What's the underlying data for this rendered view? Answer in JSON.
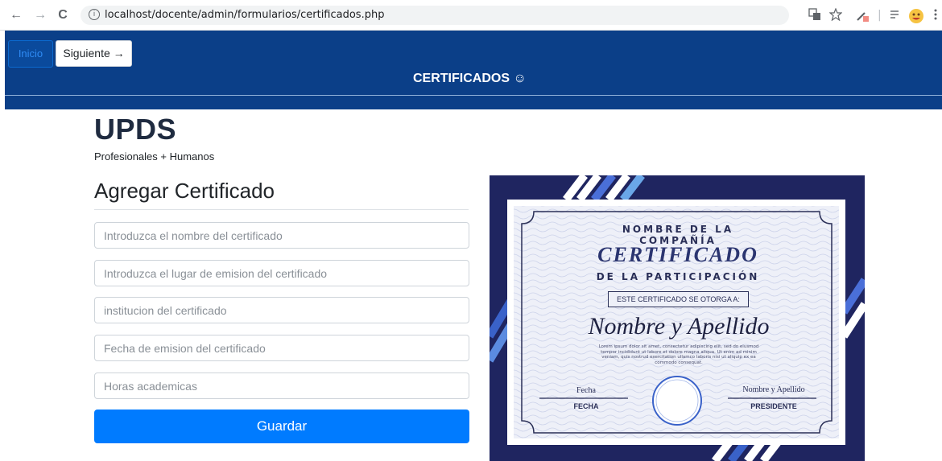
{
  "browser": {
    "url": "localhost/docente/admin/formularios/certificados.php",
    "back_glyph": "←",
    "forward_glyph": "→",
    "reload_glyph": "C",
    "info_glyph": "i"
  },
  "header": {
    "home_label": "Inicio",
    "next_label": "Siguiente →",
    "title": "CERTIFICADOS ☺",
    "bg_color": "#0b3f88"
  },
  "brand": {
    "name": "UPDS",
    "tagline": "Profesionales + Humanos"
  },
  "form": {
    "title": "Agregar Certificado",
    "fields": [
      {
        "placeholder": "Introduzca el nombre del certificado"
      },
      {
        "placeholder": "Introduzca el lugar de emision del certificado"
      },
      {
        "placeholder": "institucion del certificado"
      },
      {
        "placeholder": "Fecha de emision del certificado"
      },
      {
        "placeholder": "Horas academicas"
      }
    ],
    "submit_label": "Guardar",
    "accent_color": "#007bff"
  },
  "certificate": {
    "company": "NOMBRE DE LA COMPAÑÍA",
    "title": "CERTIFICADO",
    "subtitle": "DE LA PARTICIPACIÓN",
    "awarded_to": "ESTE CERTIFICADO SE OTORGA A:",
    "recipient": "Nombre y Apellido",
    "body": "Lorem ipsum dolor sit amet, consectetur adipiscing elit, sed do eiusmod tempor incididunt ut labore et dolore magna aliqua. Ut enim ad minim veniam, quis nostrud exercitation ullamco laboris nisi ut aliquip ex ea commodo consequat.",
    "date_signature": "Fecha",
    "date_label": "FECHA",
    "president_signature": "Nombre y Apellido",
    "president_label": "PRESIDENTE",
    "frame_color": "#2a2f57"
  }
}
